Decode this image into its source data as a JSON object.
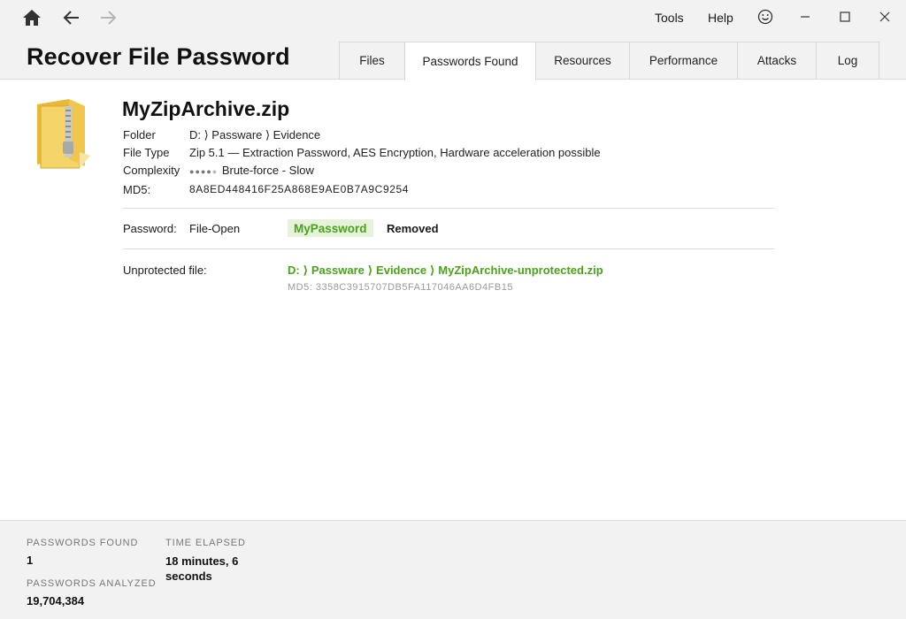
{
  "menu": {
    "tools": "Tools",
    "help": "Help"
  },
  "app_title": "Recover File Password",
  "tabs": [
    {
      "label": "Files",
      "active": false
    },
    {
      "label": "Passwords Found",
      "active": true
    },
    {
      "label": "Resources",
      "active": false
    },
    {
      "label": "Performance",
      "active": false
    },
    {
      "label": "Attacks",
      "active": false
    },
    {
      "label": "Log",
      "active": false
    }
  ],
  "file": {
    "icon": "zip-folder-icon",
    "name": "MyZipArchive.zip",
    "folder_label": "Folder",
    "folder_value": "D: ⟩ Passware ⟩ Evidence",
    "type_label": "File Type",
    "type_value": "Zip 5.1 — Extraction Password, AES Encryption, Hardware acceleration possible",
    "complexity_label": "Complexity",
    "complexity_level": 4,
    "complexity_max": 5,
    "complexity_text": "Brute-force - Slow",
    "md5_label": "MD5:",
    "md5_value": "8A8ED448416F25A868E9AE0B7A9C9254"
  },
  "password": {
    "label": "Password:",
    "kind": "File-Open",
    "value": "MyPassword",
    "status": "Removed"
  },
  "unprotected": {
    "label": "Unprotected file:",
    "path": "D: ⟩ Passware ⟩ Evidence ⟩ MyZipArchive-unprotected.zip",
    "md5": "MD5: 3358C3915707DB5FA117046AA6D4FB15"
  },
  "stats": {
    "passwords_found_label": "PASSWORDS FOUND",
    "passwords_found_value": "1",
    "time_elapsed_label": "TIME ELAPSED",
    "time_elapsed_value": "18 minutes, 6 seconds",
    "passwords_analyzed_label": "PASSWORDS ANALYZED",
    "passwords_analyzed_value": "19,704,384"
  },
  "colors": {
    "accent_green": "#4aa21c",
    "badge_bg": "#e6f2da",
    "chrome_bg": "#f2f2f2"
  }
}
